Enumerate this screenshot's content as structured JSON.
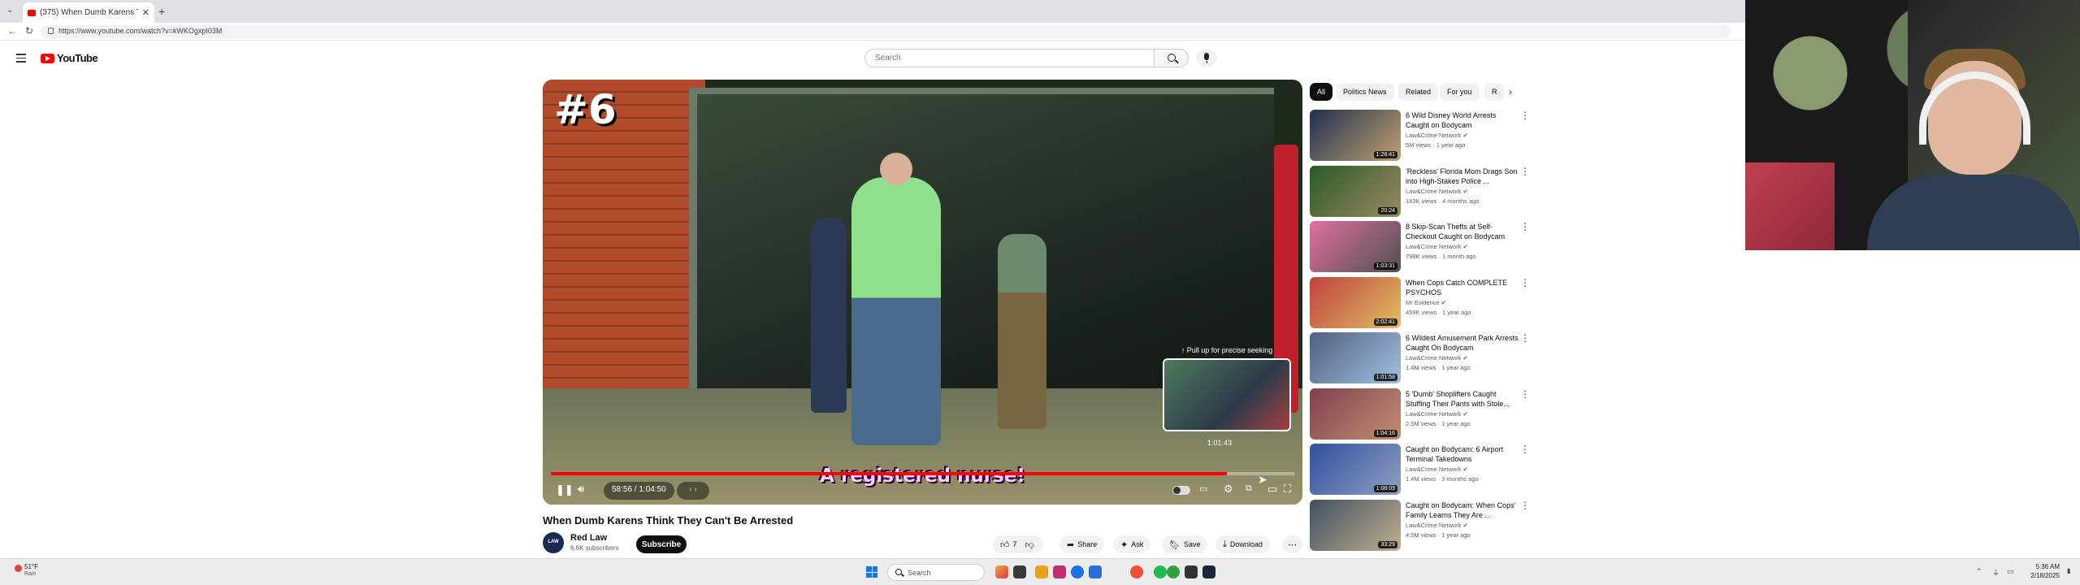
{
  "browser": {
    "tab_title": "(375) When Dumb Karens Thi",
    "tab_close": "✕",
    "new_tab": "+",
    "url": "https://www.youtube.com/watch?v=kWKOgxpI03M"
  },
  "youtube": {
    "logo_text": "YouTube",
    "search_placeholder": "Search"
  },
  "player": {
    "rank_overlay": "#6",
    "caption": "A registered nurse!",
    "preview_tip": "↑ Pull up for precise seeking",
    "hover_time": "1:01:43",
    "time_display": "58:56 / 1:04:50",
    "chapter_label": "‹ ›",
    "progress_fraction": 0.909,
    "colors": {
      "progress": "#ff0000"
    }
  },
  "video": {
    "title": "When Dumb Karens Think They Can't Be Arrested",
    "channel_name": "Red Law",
    "channel_avatar_text": "LAW",
    "channel_subs": "6.6K subscribers",
    "subscribe_label": "Subscribe",
    "like_count": "7",
    "share_label": "Share",
    "ask_label": "Ask",
    "save_label": "Save",
    "download_label": "Download"
  },
  "sidebar": {
    "chips": [
      "All",
      "Politics News",
      "Related",
      "For you",
      "R"
    ],
    "recommendations": [
      {
        "title": "6 Wild Disney World Arrests Caught on Bodycam",
        "channel": "Law&Crime Network",
        "meta": "5M views · 1 year ago",
        "duration": "1:28:41"
      },
      {
        "title": "'Reckless' Florida Mom Drags Son into High-Stakes Police ...",
        "channel": "Law&Crime Network",
        "meta": "183K views · 4 months ago",
        "duration": "20:24"
      },
      {
        "title": "8 Skip-Scan Thefts at Self-Checkout Caught on Bodycam",
        "channel": "Law&Crime Network",
        "meta": "798K views · 1 month ago",
        "duration": "1:03:31"
      },
      {
        "title": "When Cops Catch COMPLETE PSYCHOS",
        "channel": "Mr Evidence",
        "meta": "459K views · 1 year ago",
        "duration": "2:02:41"
      },
      {
        "title": "6 Wildest Amusement Park Arrests Caught On Bodycam",
        "channel": "Law&Crime Network",
        "meta": "1.4M views · 1 year ago",
        "duration": "1:01:58"
      },
      {
        "title": "5 'Dumb' Shoplifters Caught Stuffing Their Pants with Stole...",
        "channel": "Law&Crime Network",
        "meta": "2.5M views · 1 year ago",
        "duration": "1:04:16"
      },
      {
        "title": "Caught on Bodycam: 6 Airport Terminal Takedowns",
        "channel": "Law&Crime Network",
        "meta": "1.4M views · 3 months ago",
        "duration": "1:08:09"
      },
      {
        "title": "Caught on Bodycam: When Cops' Family Learns They Are ...",
        "channel": "Law&Crime Network",
        "meta": "4.5M views · 1 year ago",
        "duration": "33:29"
      }
    ]
  },
  "taskbar": {
    "weather_temp": "51°F",
    "weather_desc": "Rain",
    "search_label": "Search",
    "time": "5:36 AM",
    "date": "2/18/2025"
  }
}
